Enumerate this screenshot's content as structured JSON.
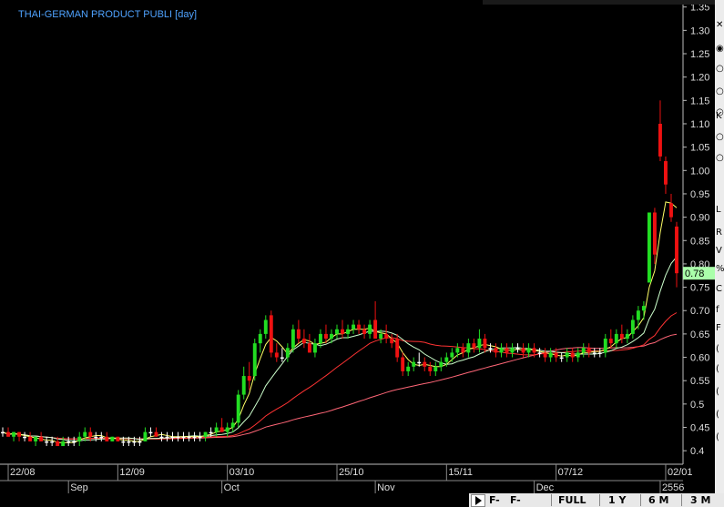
{
  "window": {
    "title": "THAI-GERMAN PRODUCT PUBLI [day]"
  },
  "colors": {
    "up": "#22dd22",
    "down": "#ee1111",
    "fast_ma": "#ffff66",
    "mid_ma": "#ccffcc",
    "slow_ma": "#ff3333",
    "long_ma": "#ff6677",
    "price_tag": "#aaffaa",
    "title": "#4fa3ff"
  },
  "right_strip": {
    "items": [
      "✕",
      "◉",
      "○",
      "○",
      "○",
      "K",
      "○",
      "○",
      "L",
      "R",
      "V",
      "%",
      "C",
      "f",
      "F",
      "(",
      "(",
      "(",
      "(",
      "("
    ]
  },
  "bottom_bar": {
    "buttons": [
      "F-",
      "F-",
      "FULL",
      "1 Y",
      "6 M",
      "3 M"
    ]
  },
  "chart_data": {
    "type": "candlestick",
    "title": "THAI-GERMAN PRODUCT PUBLI [day]",
    "y_ticks": [
      "1.35",
      "1.30",
      "1.25",
      "1.20",
      "1.15",
      "1.10",
      "1.05",
      "1.00",
      "0.95",
      "0.90",
      "0.85",
      "0.80",
      "0.75",
      "0.70",
      "0.65",
      "0.60",
      "0.55",
      "0.5",
      "0.45",
      "0.4"
    ],
    "ylim": [
      0.375,
      1.365
    ],
    "x_ticks_upper": [
      "22/08",
      "12/09",
      "03/10",
      "25/10",
      "15/11",
      "07/12",
      "02/01"
    ],
    "x_ticks_lower": [
      "Sep",
      "Oct",
      "Nov",
      "Dec",
      "2556"
    ],
    "last_price": "0.78",
    "candles": [
      {
        "o": 0.44,
        "h": 0.45,
        "l": 0.43,
        "c": 0.44
      },
      {
        "o": 0.44,
        "h": 0.45,
        "l": 0.43,
        "c": 0.43
      },
      {
        "o": 0.43,
        "h": 0.44,
        "l": 0.42,
        "c": 0.44
      },
      {
        "o": 0.44,
        "h": 0.44,
        "l": 0.42,
        "c": 0.43
      },
      {
        "o": 0.43,
        "h": 0.44,
        "l": 0.42,
        "c": 0.43
      },
      {
        "o": 0.43,
        "h": 0.44,
        "l": 0.42,
        "c": 0.42
      },
      {
        "o": 0.42,
        "h": 0.43,
        "l": 0.41,
        "c": 0.43
      },
      {
        "o": 0.43,
        "h": 0.44,
        "l": 0.42,
        "c": 0.42
      },
      {
        "o": 0.42,
        "h": 0.43,
        "l": 0.41,
        "c": 0.42
      },
      {
        "o": 0.42,
        "h": 0.43,
        "l": 0.41,
        "c": 0.42
      },
      {
        "o": 0.42,
        "h": 0.43,
        "l": 0.41,
        "c": 0.41
      },
      {
        "o": 0.41,
        "h": 0.43,
        "l": 0.41,
        "c": 0.42
      },
      {
        "o": 0.42,
        "h": 0.43,
        "l": 0.41,
        "c": 0.42
      },
      {
        "o": 0.42,
        "h": 0.43,
        "l": 0.41,
        "c": 0.42
      },
      {
        "o": 0.42,
        "h": 0.44,
        "l": 0.41,
        "c": 0.43
      },
      {
        "o": 0.43,
        "h": 0.45,
        "l": 0.42,
        "c": 0.44
      },
      {
        "o": 0.44,
        "h": 0.45,
        "l": 0.42,
        "c": 0.43
      },
      {
        "o": 0.43,
        "h": 0.44,
        "l": 0.42,
        "c": 0.43
      },
      {
        "o": 0.43,
        "h": 0.44,
        "l": 0.42,
        "c": 0.43
      },
      {
        "o": 0.43,
        "h": 0.44,
        "l": 0.42,
        "c": 0.42
      },
      {
        "o": 0.42,
        "h": 0.43,
        "l": 0.42,
        "c": 0.43
      },
      {
        "o": 0.43,
        "h": 0.43,
        "l": 0.42,
        "c": 0.42
      },
      {
        "o": 0.42,
        "h": 0.43,
        "l": 0.41,
        "c": 0.42
      },
      {
        "o": 0.42,
        "h": 0.43,
        "l": 0.41,
        "c": 0.42
      },
      {
        "o": 0.42,
        "h": 0.43,
        "l": 0.41,
        "c": 0.42
      },
      {
        "o": 0.42,
        "h": 0.43,
        "l": 0.41,
        "c": 0.42
      },
      {
        "o": 0.42,
        "h": 0.45,
        "l": 0.42,
        "c": 0.44
      },
      {
        "o": 0.44,
        "h": 0.45,
        "l": 0.43,
        "c": 0.44
      },
      {
        "o": 0.44,
        "h": 0.45,
        "l": 0.43,
        "c": 0.43
      },
      {
        "o": 0.43,
        "h": 0.44,
        "l": 0.42,
        "c": 0.43
      },
      {
        "o": 0.43,
        "h": 0.44,
        "l": 0.42,
        "c": 0.43
      },
      {
        "o": 0.43,
        "h": 0.44,
        "l": 0.42,
        "c": 0.43
      },
      {
        "o": 0.43,
        "h": 0.44,
        "l": 0.42,
        "c": 0.43
      },
      {
        "o": 0.43,
        "h": 0.44,
        "l": 0.42,
        "c": 0.43
      },
      {
        "o": 0.43,
        "h": 0.44,
        "l": 0.42,
        "c": 0.43
      },
      {
        "o": 0.43,
        "h": 0.44,
        "l": 0.42,
        "c": 0.43
      },
      {
        "o": 0.43,
        "h": 0.44,
        "l": 0.42,
        "c": 0.43
      },
      {
        "o": 0.43,
        "h": 0.44,
        "l": 0.42,
        "c": 0.44
      },
      {
        "o": 0.44,
        "h": 0.45,
        "l": 0.43,
        "c": 0.44
      },
      {
        "o": 0.44,
        "h": 0.46,
        "l": 0.43,
        "c": 0.45
      },
      {
        "o": 0.45,
        "h": 0.47,
        "l": 0.44,
        "c": 0.44
      },
      {
        "o": 0.44,
        "h": 0.46,
        "l": 0.43,
        "c": 0.45
      },
      {
        "o": 0.45,
        "h": 0.47,
        "l": 0.44,
        "c": 0.46
      },
      {
        "o": 0.46,
        "h": 0.53,
        "l": 0.45,
        "c": 0.52
      },
      {
        "o": 0.52,
        "h": 0.58,
        "l": 0.51,
        "c": 0.56
      },
      {
        "o": 0.56,
        "h": 0.59,
        "l": 0.53,
        "c": 0.55
      },
      {
        "o": 0.56,
        "h": 0.64,
        "l": 0.55,
        "c": 0.63
      },
      {
        "o": 0.63,
        "h": 0.66,
        "l": 0.61,
        "c": 0.65
      },
      {
        "o": 0.65,
        "h": 0.69,
        "l": 0.64,
        "c": 0.68
      },
      {
        "o": 0.69,
        "h": 0.7,
        "l": 0.6,
        "c": 0.61
      },
      {
        "o": 0.61,
        "h": 0.63,
        "l": 0.59,
        "c": 0.6
      },
      {
        "o": 0.6,
        "h": 0.62,
        "l": 0.59,
        "c": 0.6
      },
      {
        "o": 0.6,
        "h": 0.63,
        "l": 0.59,
        "c": 0.62
      },
      {
        "o": 0.62,
        "h": 0.67,
        "l": 0.61,
        "c": 0.66
      },
      {
        "o": 0.66,
        "h": 0.68,
        "l": 0.63,
        "c": 0.64
      },
      {
        "o": 0.64,
        "h": 0.66,
        "l": 0.62,
        "c": 0.63
      },
      {
        "o": 0.63,
        "h": 0.65,
        "l": 0.61,
        "c": 0.61
      },
      {
        "o": 0.61,
        "h": 0.64,
        "l": 0.6,
        "c": 0.63
      },
      {
        "o": 0.63,
        "h": 0.66,
        "l": 0.62,
        "c": 0.65
      },
      {
        "o": 0.65,
        "h": 0.67,
        "l": 0.63,
        "c": 0.64
      },
      {
        "o": 0.64,
        "h": 0.66,
        "l": 0.63,
        "c": 0.65
      },
      {
        "o": 0.65,
        "h": 0.67,
        "l": 0.64,
        "c": 0.66
      },
      {
        "o": 0.66,
        "h": 0.68,
        "l": 0.64,
        "c": 0.65
      },
      {
        "o": 0.65,
        "h": 0.67,
        "l": 0.64,
        "c": 0.66
      },
      {
        "o": 0.66,
        "h": 0.68,
        "l": 0.65,
        "c": 0.67
      },
      {
        "o": 0.67,
        "h": 0.68,
        "l": 0.65,
        "c": 0.66
      },
      {
        "o": 0.66,
        "h": 0.67,
        "l": 0.64,
        "c": 0.65
      },
      {
        "o": 0.65,
        "h": 0.68,
        "l": 0.64,
        "c": 0.67
      },
      {
        "o": 0.68,
        "h": 0.72,
        "l": 0.64,
        "c": 0.64
      },
      {
        "o": 0.64,
        "h": 0.66,
        "l": 0.63,
        "c": 0.65
      },
      {
        "o": 0.65,
        "h": 0.67,
        "l": 0.63,
        "c": 0.64
      },
      {
        "o": 0.64,
        "h": 0.65,
        "l": 0.62,
        "c": 0.63
      },
      {
        "o": 0.64,
        "h": 0.65,
        "l": 0.59,
        "c": 0.6
      },
      {
        "o": 0.6,
        "h": 0.61,
        "l": 0.56,
        "c": 0.57
      },
      {
        "o": 0.57,
        "h": 0.59,
        "l": 0.56,
        "c": 0.58
      },
      {
        "o": 0.58,
        "h": 0.6,
        "l": 0.57,
        "c": 0.59
      },
      {
        "o": 0.59,
        "h": 0.61,
        "l": 0.58,
        "c": 0.59
      },
      {
        "o": 0.59,
        "h": 0.6,
        "l": 0.57,
        "c": 0.58
      },
      {
        "o": 0.58,
        "h": 0.59,
        "l": 0.56,
        "c": 0.57
      },
      {
        "o": 0.57,
        "h": 0.59,
        "l": 0.56,
        "c": 0.58
      },
      {
        "o": 0.58,
        "h": 0.6,
        "l": 0.57,
        "c": 0.59
      },
      {
        "o": 0.59,
        "h": 0.61,
        "l": 0.58,
        "c": 0.6
      },
      {
        "o": 0.6,
        "h": 0.62,
        "l": 0.59,
        "c": 0.61
      },
      {
        "o": 0.61,
        "h": 0.63,
        "l": 0.6,
        "c": 0.62
      },
      {
        "o": 0.62,
        "h": 0.63,
        "l": 0.6,
        "c": 0.61
      },
      {
        "o": 0.61,
        "h": 0.64,
        "l": 0.6,
        "c": 0.63
      },
      {
        "o": 0.63,
        "h": 0.64,
        "l": 0.61,
        "c": 0.62
      },
      {
        "o": 0.62,
        "h": 0.66,
        "l": 0.61,
        "c": 0.64
      },
      {
        "o": 0.64,
        "h": 0.65,
        "l": 0.61,
        "c": 0.62
      },
      {
        "o": 0.62,
        "h": 0.63,
        "l": 0.61,
        "c": 0.62
      },
      {
        "o": 0.62,
        "h": 0.63,
        "l": 0.6,
        "c": 0.61
      },
      {
        "o": 0.61,
        "h": 0.63,
        "l": 0.6,
        "c": 0.62
      },
      {
        "o": 0.62,
        "h": 0.63,
        "l": 0.6,
        "c": 0.61
      },
      {
        "o": 0.61,
        "h": 0.63,
        "l": 0.6,
        "c": 0.62
      },
      {
        "o": 0.62,
        "h": 0.63,
        "l": 0.61,
        "c": 0.62
      },
      {
        "o": 0.62,
        "h": 0.63,
        "l": 0.6,
        "c": 0.61
      },
      {
        "o": 0.61,
        "h": 0.63,
        "l": 0.6,
        "c": 0.62
      },
      {
        "o": 0.62,
        "h": 0.63,
        "l": 0.6,
        "c": 0.61
      },
      {
        "o": 0.61,
        "h": 0.62,
        "l": 0.6,
        "c": 0.61
      },
      {
        "o": 0.61,
        "h": 0.62,
        "l": 0.59,
        "c": 0.6
      },
      {
        "o": 0.6,
        "h": 0.62,
        "l": 0.59,
        "c": 0.61
      },
      {
        "o": 0.61,
        "h": 0.62,
        "l": 0.59,
        "c": 0.6
      },
      {
        "o": 0.6,
        "h": 0.61,
        "l": 0.59,
        "c": 0.6
      },
      {
        "o": 0.6,
        "h": 0.62,
        "l": 0.59,
        "c": 0.61
      },
      {
        "o": 0.61,
        "h": 0.62,
        "l": 0.59,
        "c": 0.6
      },
      {
        "o": 0.6,
        "h": 0.62,
        "l": 0.59,
        "c": 0.61
      },
      {
        "o": 0.61,
        "h": 0.63,
        "l": 0.6,
        "c": 0.62
      },
      {
        "o": 0.62,
        "h": 0.63,
        "l": 0.6,
        "c": 0.61
      },
      {
        "o": 0.61,
        "h": 0.62,
        "l": 0.6,
        "c": 0.61
      },
      {
        "o": 0.61,
        "h": 0.62,
        "l": 0.6,
        "c": 0.61
      },
      {
        "o": 0.61,
        "h": 0.65,
        "l": 0.6,
        "c": 0.64
      },
      {
        "o": 0.64,
        "h": 0.66,
        "l": 0.62,
        "c": 0.63
      },
      {
        "o": 0.63,
        "h": 0.66,
        "l": 0.62,
        "c": 0.65
      },
      {
        "o": 0.65,
        "h": 0.67,
        "l": 0.63,
        "c": 0.64
      },
      {
        "o": 0.64,
        "h": 0.66,
        "l": 0.63,
        "c": 0.65
      },
      {
        "o": 0.65,
        "h": 0.69,
        "l": 0.64,
        "c": 0.68
      },
      {
        "o": 0.68,
        "h": 0.71,
        "l": 0.66,
        "c": 0.7
      },
      {
        "o": 0.7,
        "h": 0.72,
        "l": 0.68,
        "c": 0.71
      },
      {
        "o": 0.76,
        "h": 0.91,
        "l": 0.76,
        "c": 0.91
      },
      {
        "o": 0.91,
        "h": 0.92,
        "l": 0.8,
        "c": 0.82
      },
      {
        "o": 1.1,
        "h": 1.15,
        "l": 1.02,
        "c": 1.03
      },
      {
        "o": 1.02,
        "h": 1.03,
        "l": 0.95,
        "c": 0.97
      },
      {
        "o": 0.93,
        "h": 0.95,
        "l": 0.89,
        "c": 0.9
      },
      {
        "o": 0.88,
        "h": 0.89,
        "l": 0.75,
        "c": 0.78
      }
    ]
  }
}
